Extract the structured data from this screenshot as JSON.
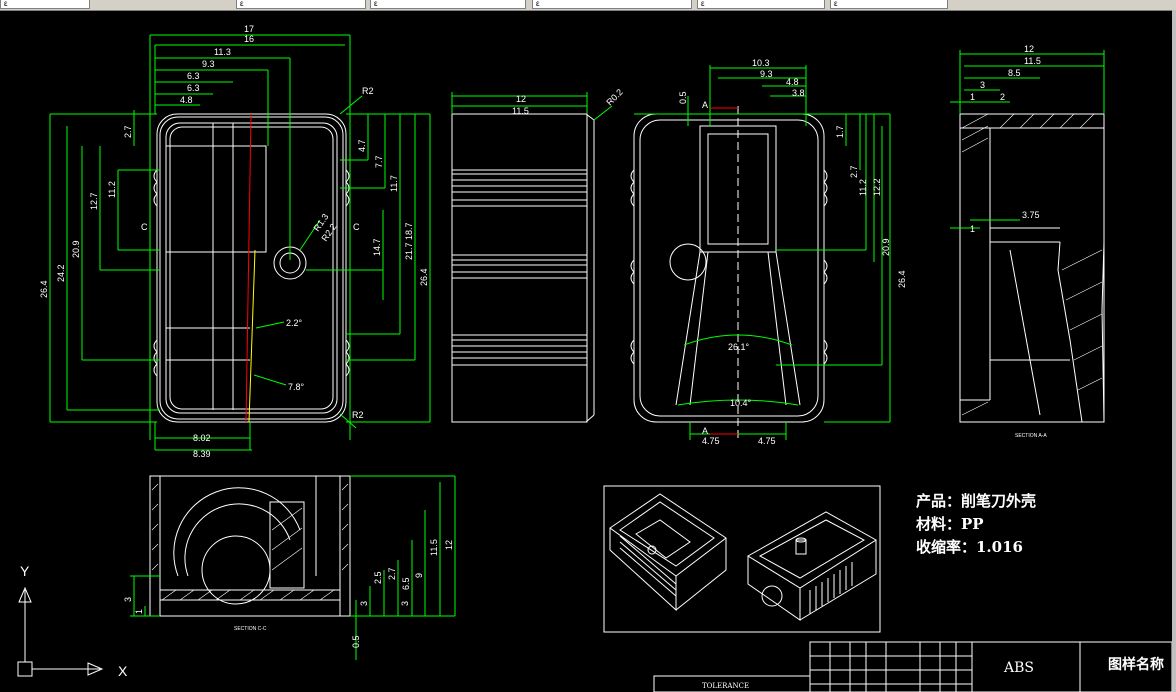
{
  "toolbar": {
    "tabs": [
      "ε",
      "ε",
      "ε",
      "ε",
      "ε",
      "ε"
    ]
  },
  "drawing": {
    "top_dims": [
      "17",
      "16",
      "11.3",
      "9.3",
      "6.3",
      "6.3",
      "4.8",
      "R2"
    ],
    "left_dims": [
      "26.4",
      "24.2",
      "20.9",
      "12.7",
      "11.2",
      "2.7"
    ],
    "right_dims": [
      "4.7",
      "7.7",
      "11.7",
      "14.7",
      "18.7",
      "21.7",
      "26.4"
    ],
    "hole_dims": [
      "R1.3",
      "R2.2"
    ],
    "section_c": "C",
    "angle1": "2.2°",
    "angle2": "7.8°",
    "bottom_dims": [
      "8.02",
      "8.39",
      "R2"
    ],
    "side_dims": [
      "12",
      "11.5",
      "R0.2"
    ],
    "front_top": [
      "10.3",
      "9.3",
      "4.8",
      "3.8",
      "0.5"
    ],
    "front_right": [
      "1.7",
      "2.7",
      "11.2",
      "12.2",
      "20.9",
      "26.4"
    ],
    "front_angle": "26.1°",
    "front_angle2": "10.4°",
    "front_bottom": [
      "4.75",
      "4.75"
    ],
    "section_a": "A",
    "sect_top": [
      "12",
      "11.5",
      "8.5",
      "3",
      "1",
      "2"
    ],
    "sect_mid": [
      "3.75",
      "1"
    ],
    "sect_label": "SECTION A-A",
    "bot_right": [
      "12",
      "11.5",
      "9",
      "6.5",
      "2.7",
      "2.5",
      "3",
      "3"
    ],
    "bot_left": [
      "3",
      "1"
    ],
    "bot_dim": "0.5",
    "bot_label": "SECTION C-C",
    "ucs": {
      "y": "Y",
      "x": "X"
    },
    "info": {
      "product": "产品：削笔刀外壳",
      "material": "材料：PP",
      "shrink": "收缩率：1.016"
    },
    "title_block": {
      "material": "ABS",
      "name": "图样名称",
      "tolerance": "TOLERANCE"
    }
  }
}
